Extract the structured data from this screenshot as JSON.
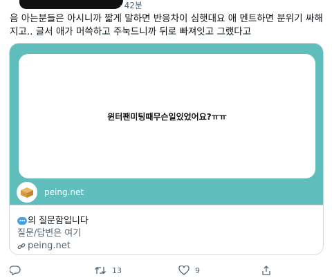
{
  "tweet": {
    "time": "· 42분",
    "text": "음 아는분들은 아시니까 짧게 말하면 반응차이 심햇대요 애 멘트하면 분위기 싸해지고.. 글서 애가 머쓱하고 주눅드니까 뒤로 빠져잇고 그랬다고"
  },
  "card": {
    "question": "윈터팬미팅때무슨일있었어요?ㅠㅠ",
    "brand_name": "peing.net",
    "title": "의 질문함입니다",
    "description": "질문/답변은 여기",
    "domain": "peing.net"
  },
  "actions": {
    "reply_count": "",
    "retweet_count": "13",
    "like_count": "9"
  }
}
